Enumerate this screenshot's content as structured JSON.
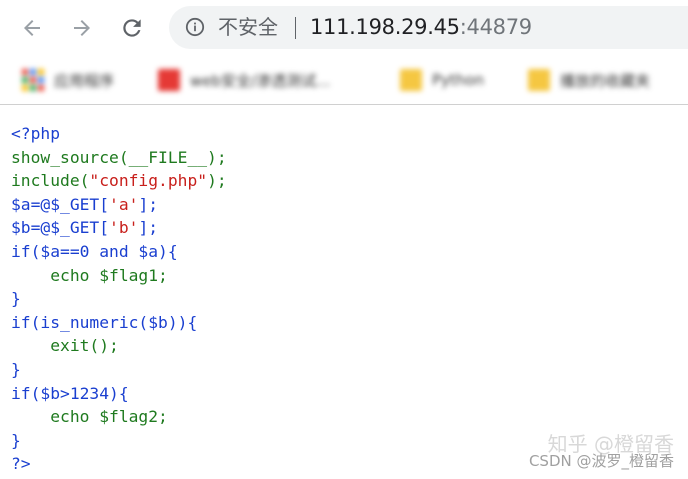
{
  "browser": {
    "security_label": "不安全",
    "url_host": "111.198.29.45",
    "url_port": ":44879",
    "icons": {
      "back": "arrow-left-icon",
      "forward": "arrow-right-icon",
      "reload": "reload-icon",
      "info": "info-icon",
      "apps": "apps-grid-icon",
      "folder": "folder-icon"
    },
    "colors": {
      "omnibox_bg": "#f1f3f4",
      "icon": "#5f6368"
    }
  },
  "bookmarks": [
    {
      "label": "应用程序",
      "icon": "apps-grid-icon",
      "color": "#4285f4"
    },
    {
      "label": "web安全/渗透测试...",
      "icon": "bookmark-favicon",
      "color": "#e53935"
    },
    {
      "label": "Python",
      "icon": "folder-icon",
      "color": "#f5c742"
    },
    {
      "label": "播放的收藏夹",
      "icon": "folder-icon",
      "color": "#f5c742"
    }
  ],
  "code": {
    "colors": {
      "keyword": "#1a3fd0",
      "function": "#1f7a1f",
      "string": "#c8201c",
      "variable": "#1a3fd0",
      "default": "#1a3fd0"
    },
    "lines": [
      [
        {
          "t": "<?php",
          "c": "#1a3fd0"
        }
      ],
      [
        {
          "t": "show_source(__FILE__);",
          "c": "#1f7a1f"
        }
      ],
      [
        {
          "t": "include(",
          "c": "#1f7a1f"
        },
        {
          "t": "\"config.php\"",
          "c": "#c8201c"
        },
        {
          "t": ");",
          "c": "#1f7a1f"
        }
      ],
      [
        {
          "t": "$a=@$_GET[",
          "c": "#1a3fd0"
        },
        {
          "t": "'a'",
          "c": "#c8201c"
        },
        {
          "t": "];",
          "c": "#1a3fd0"
        }
      ],
      [
        {
          "t": "$b=@$_GET[",
          "c": "#1a3fd0"
        },
        {
          "t": "'b'",
          "c": "#c8201c"
        },
        {
          "t": "];",
          "c": "#1a3fd0"
        }
      ],
      [
        {
          "t": "if($a==0 and $a){",
          "c": "#1a3fd0"
        }
      ],
      [
        {
          "t": "    echo $flag1;",
          "c": "#1f7a1f"
        }
      ],
      [
        {
          "t": "}",
          "c": "#1a3fd0"
        }
      ],
      [
        {
          "t": "if(is_numeric($b)){",
          "c": "#1a3fd0"
        }
      ],
      [
        {
          "t": "    exit();",
          "c": "#1f7a1f"
        }
      ],
      [
        {
          "t": "}",
          "c": "#1a3fd0"
        }
      ],
      [
        {
          "t": "if($b>1234){",
          "c": "#1a3fd0"
        }
      ],
      [
        {
          "t": "    echo $flag2;",
          "c": "#1f7a1f"
        }
      ],
      [
        {
          "t": "}",
          "c": "#1a3fd0"
        }
      ],
      [
        {
          "t": "?>",
          "c": "#1a3fd0"
        }
      ]
    ]
  },
  "watermark": {
    "zhihu": "知乎 @橙留香",
    "csdn": "CSDN @波罗_橙留香"
  }
}
